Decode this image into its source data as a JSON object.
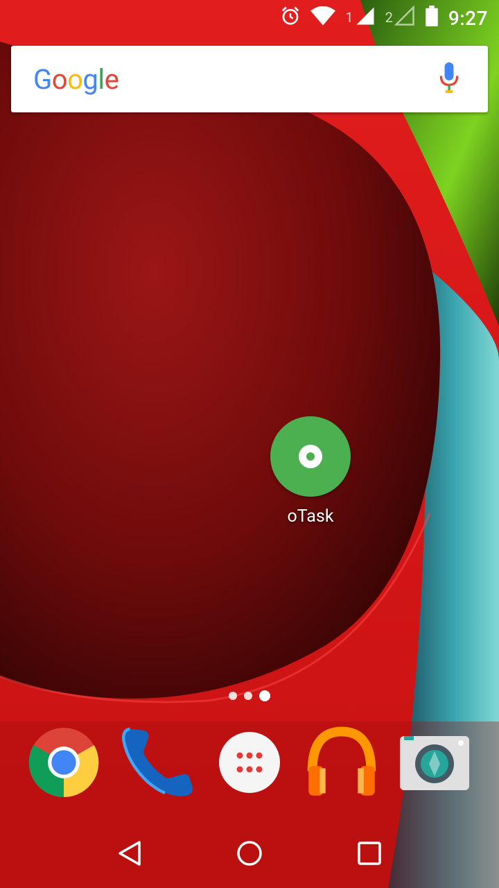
{
  "status_bar": {
    "time": "9:27",
    "sim1_label": "1",
    "sim2_label": "2",
    "icons": [
      "alarm-icon",
      "wifi-icon",
      "signal-icon",
      "signal-icon",
      "battery-icon"
    ]
  },
  "search": {
    "logo_letters": [
      {
        "char": "G",
        "color": "#4285F4"
      },
      {
        "char": "o",
        "color": "#EA4335"
      },
      {
        "char": "o",
        "color": "#FBBC05"
      },
      {
        "char": "g",
        "color": "#4285F4"
      },
      {
        "char": "l",
        "color": "#34A853"
      },
      {
        "char": "e",
        "color": "#EA4335"
      }
    ],
    "mic_icon": "mic-icon"
  },
  "home": {
    "apps": [
      {
        "label": "oTask",
        "icon": "otask-icon",
        "color": "#4CAF50"
      }
    ]
  },
  "page_indicator": {
    "count": 3,
    "active_index": 2
  },
  "dock": {
    "apps": [
      {
        "name": "Chrome",
        "icon": "chrome-icon"
      },
      {
        "name": "Phone",
        "icon": "phone-icon"
      },
      {
        "name": "Apps",
        "icon": "app-drawer-icon"
      },
      {
        "name": "Play Music",
        "icon": "headphones-icon"
      },
      {
        "name": "Camera",
        "icon": "camera-icon"
      }
    ]
  },
  "nav": {
    "back_icon": "back-icon",
    "home_icon": "home-icon",
    "recents_icon": "recents-icon"
  }
}
